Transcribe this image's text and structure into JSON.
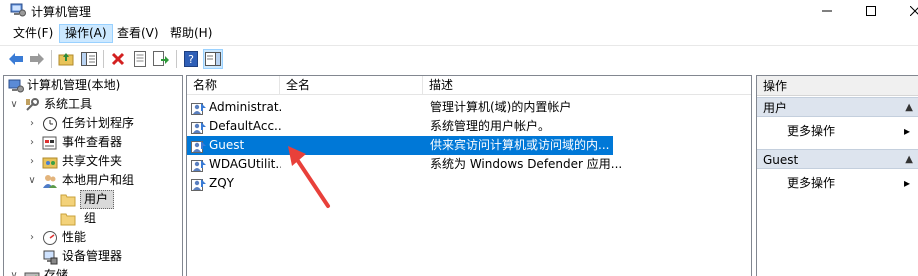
{
  "window": {
    "title": "计算机管理"
  },
  "menu": [
    {
      "label": "文件(F)"
    },
    {
      "label": "操作(A)"
    },
    {
      "label": "查看(V)"
    },
    {
      "label": "帮助(H)"
    }
  ],
  "toolbar": {
    "buttons": [
      "back-icon",
      "forward-icon",
      "up-folder-icon",
      "show-hide-tree-icon",
      "delete-icon",
      "properties-icon",
      "export-list-icon",
      "help-icon",
      "show-hide-action-pane-icon"
    ]
  },
  "tree": {
    "items": [
      {
        "label": "计算机管理(本地)"
      },
      {
        "label": "系统工具"
      },
      {
        "label": "任务计划程序"
      },
      {
        "label": "事件查看器"
      },
      {
        "label": "共享文件夹"
      },
      {
        "label": "本地用户和组"
      },
      {
        "label": "用户"
      },
      {
        "label": "组"
      },
      {
        "label": "性能"
      },
      {
        "label": "设备管理器"
      },
      {
        "label": "存储"
      }
    ]
  },
  "list": {
    "columns": [
      "名称",
      "全名",
      "描述"
    ],
    "rows": [
      {
        "name": "Administrat...",
        "fullname": "",
        "desc": "管理计算机(域)的内置帐户"
      },
      {
        "name": "DefaultAcc...",
        "fullname": "",
        "desc": "系统管理的用户帐户。"
      },
      {
        "name": "Guest",
        "fullname": "",
        "desc": "供来宾访问计算机或访问域的内..."
      },
      {
        "name": "WDAGUtilit...",
        "fullname": "",
        "desc": "系统为 Windows Defender 应用..."
      },
      {
        "name": "ZQY",
        "fullname": "",
        "desc": ""
      }
    ],
    "selected_index": 2
  },
  "actions": {
    "header": "操作",
    "sections": [
      {
        "title": "用户",
        "items": [
          "更多操作"
        ]
      },
      {
        "title": "Guest",
        "items": [
          "更多操作"
        ]
      }
    ]
  },
  "colors": {
    "selection": "#0078d7",
    "annotation_arrow": "#e8403a"
  }
}
